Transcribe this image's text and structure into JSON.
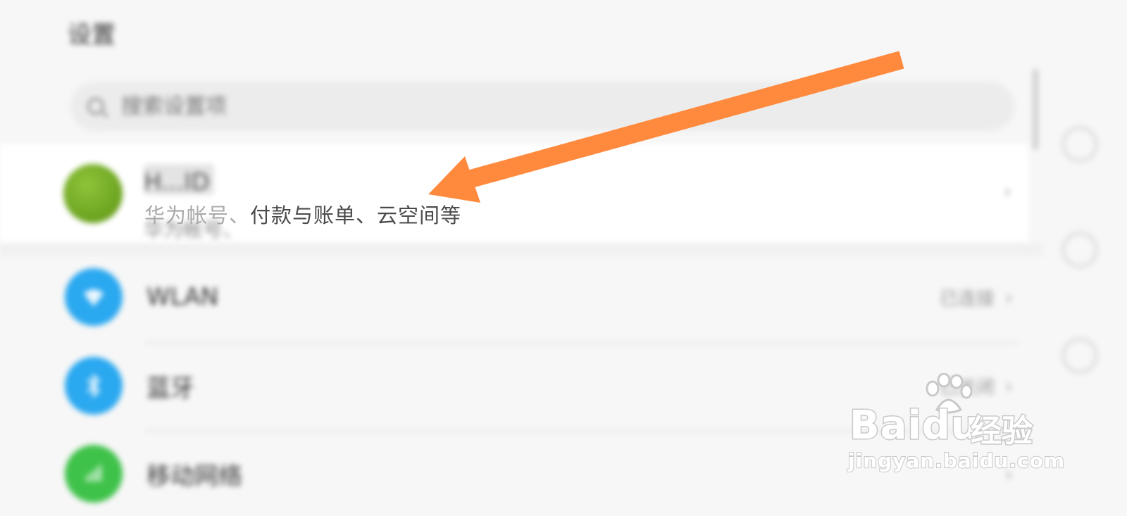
{
  "header": {
    "title": "设置"
  },
  "search": {
    "placeholder": "搜索设置项"
  },
  "account": {
    "name": "H...ID",
    "subtitle_faded": "华为帐号、",
    "subtitle_visible": "付款与账单、云空间等"
  },
  "settings": [
    {
      "label": "WLAN",
      "value": "已连接",
      "icon": "wifi-icon",
      "color": "#2aa8f0"
    },
    {
      "label": "蓝牙",
      "value": "已关闭",
      "icon": "bluetooth-icon",
      "color": "#2aa8f0"
    },
    {
      "label": "移动网络",
      "value": "",
      "icon": "mobile-network-icon",
      "color": "#3fc24a"
    }
  ],
  "annotation": {
    "arrow_color": "#ff8a3d"
  },
  "watermark": {
    "brand": "Baidu",
    "product": "经验",
    "url": "jingyan.baidu.com"
  }
}
